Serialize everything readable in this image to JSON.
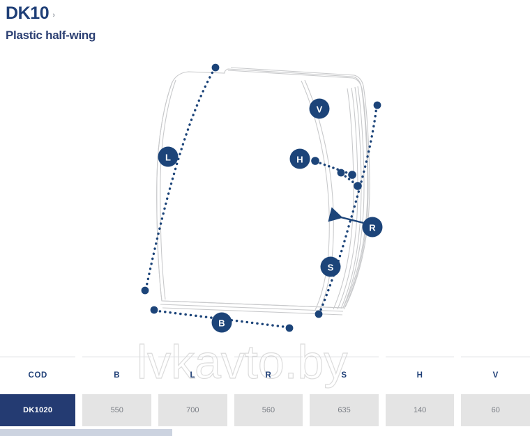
{
  "header": {
    "product_code": "DK10",
    "chevron": "›",
    "product_name": "Plastic half-wing"
  },
  "watermark": {
    "text": "lvkavto.by"
  },
  "diagram": {
    "description": "Technical drawing of curved plastic half-wing panel with dimension callouts",
    "callouts": [
      {
        "label": "L",
        "name": "length-callout"
      },
      {
        "label": "B",
        "name": "width-callout"
      },
      {
        "label": "V",
        "name": "v-callout"
      },
      {
        "label": "H",
        "name": "h-callout"
      },
      {
        "label": "R",
        "name": "radius-callout"
      },
      {
        "label": "S",
        "name": "s-callout"
      }
    ]
  },
  "colors": {
    "navy": "#1f3f77",
    "marker_navy": "#1c4479",
    "code_cell": "#243b72",
    "cell_gray": "#e4e4e4",
    "outline_gray": "#c9cacc"
  },
  "table": {
    "headers": [
      "COD",
      "B",
      "L",
      "R",
      "S",
      "H",
      "V"
    ],
    "rows": [
      {
        "cod": "DK1020",
        "B": "550",
        "L": "700",
        "R": "560",
        "S": "635",
        "H": "140",
        "V": "60"
      }
    ]
  }
}
